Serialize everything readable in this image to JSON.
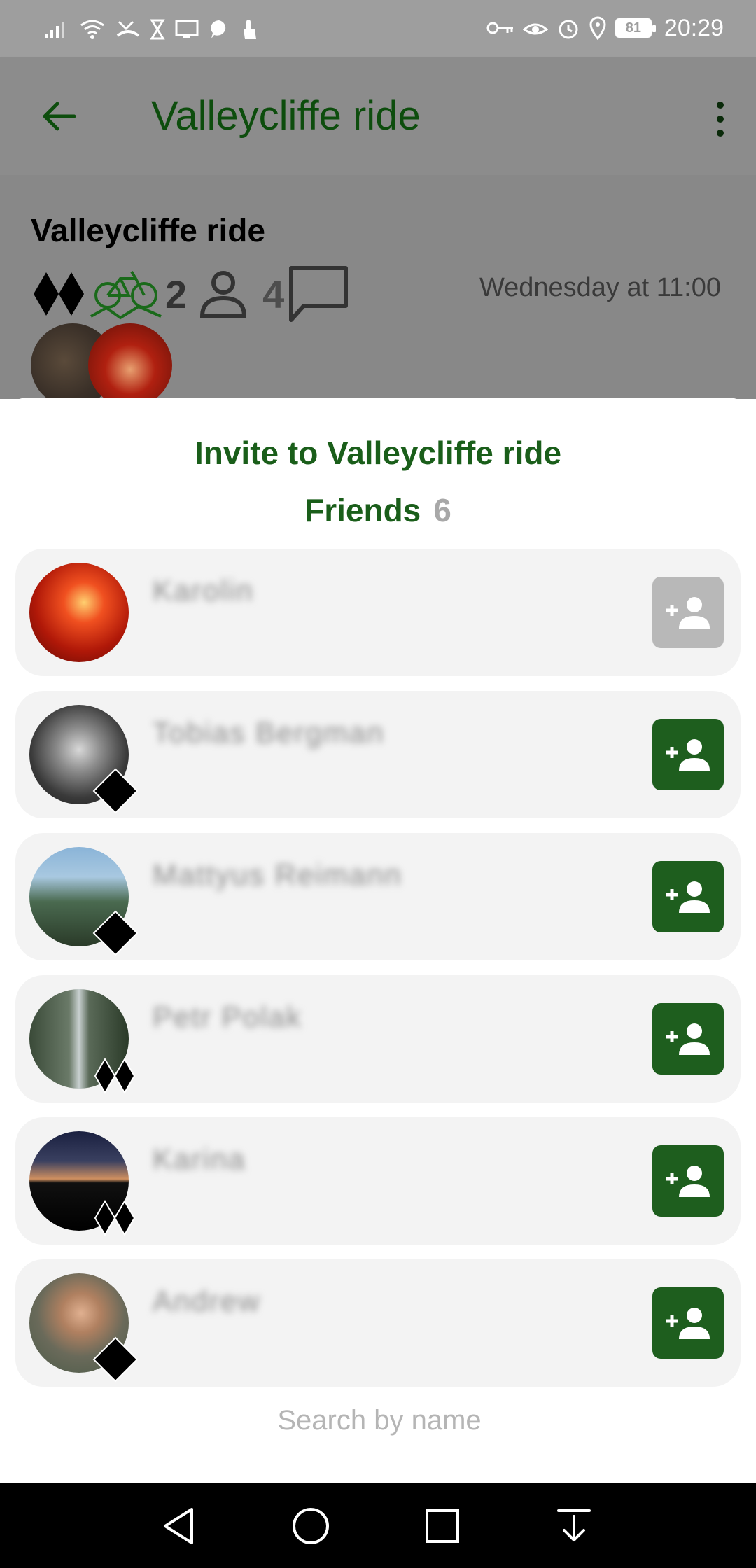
{
  "status_bar": {
    "time": "20:29",
    "battery": "81",
    "icons": [
      "signal-icon",
      "wifi-icon",
      "missed-call-icon",
      "hourglass-icon",
      "screen-cast-icon",
      "chat-bubble-icon",
      "touch-icon",
      "key-icon",
      "eye-icon",
      "alarm-icon",
      "location-icon"
    ]
  },
  "app_bar": {
    "title": "Valleycliffe ride",
    "back_icon": "arrow-back-icon",
    "menu_icon": "more-vert-icon"
  },
  "ride": {
    "title": "Valleycliffe ride",
    "difficulty_icon": "double-black-diamond-icon",
    "bike_icon": "mountain-bike-icon",
    "bike_count": "2",
    "participants_count": "4",
    "date": "Wednesday at 11:00"
  },
  "sheet": {
    "title": "Invite to Valleycliffe ride",
    "friends_label": "Friends",
    "friends_count": "6",
    "search_placeholder": "Search by name"
  },
  "friends": [
    {
      "name": "Karolin",
      "badge": "none",
      "invite_enabled": false,
      "avatar_color": "#c0281a"
    },
    {
      "name": "Tobias Bergman",
      "badge": "single-diamond",
      "invite_enabled": true,
      "avatar_color": "#555555"
    },
    {
      "name": "Mattyus Reimann",
      "badge": "single-diamond",
      "invite_enabled": true,
      "avatar_color": "#6e8fa8"
    },
    {
      "name": "Petr Polak",
      "badge": "double-diamond",
      "invite_enabled": true,
      "avatar_color": "#4d5a48"
    },
    {
      "name": "Karina",
      "badge": "double-diamond",
      "invite_enabled": true,
      "avatar_color": "#1a1a2a"
    },
    {
      "name": "Andrew",
      "badge": "single-diamond",
      "invite_enabled": true,
      "avatar_color": "#7a6a5a"
    }
  ],
  "colors": {
    "primary": "#1e5e1e",
    "disabled": "#b8b8b8",
    "card_bg": "#f3f3f3",
    "count": "#a8a8a8"
  },
  "nav_bar": {
    "icons": [
      "back-triangle-icon",
      "home-circle-icon",
      "recents-square-icon",
      "notification-pull-icon"
    ]
  }
}
